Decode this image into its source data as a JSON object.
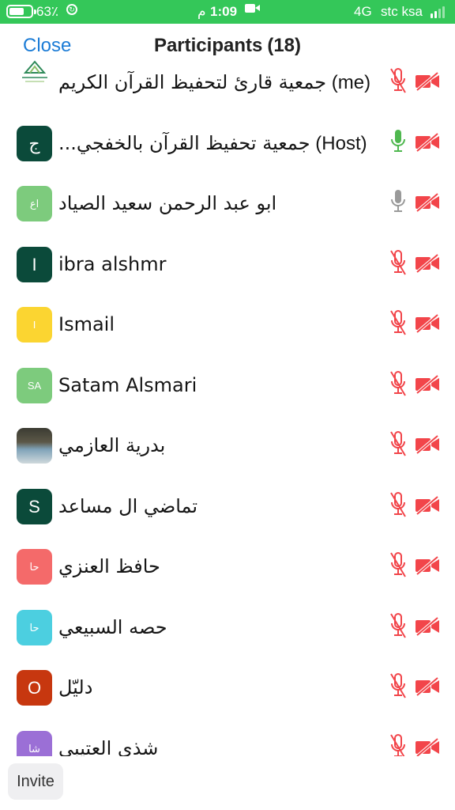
{
  "status_bar": {
    "battery_pct": "63٪",
    "time": "1:09",
    "ampm": "م",
    "network": "4G",
    "carrier": "stc ksa"
  },
  "header": {
    "close_label": "Close",
    "title": "Participants",
    "count": "(18)"
  },
  "participants": [
    {
      "name": "جمعية قارئ لتحفيظ القرآن الكريم",
      "tag": "(me)",
      "avatar_text": "",
      "avatar_type": "logo",
      "avatar_color": "#ffffff",
      "mic": "muted",
      "video": "off"
    },
    {
      "name": "جمعية تحفيظ القرآن بالخفجي...",
      "tag": "(Host)",
      "avatar_text": "ج",
      "avatar_type": "letter",
      "avatar_color": "#0b4a3a",
      "mic": "on",
      "video": "off"
    },
    {
      "name": "ابو عبد الرحمن سعيد الصياد",
      "tag": "",
      "avatar_text": "اع",
      "avatar_type": "letter-small",
      "avatar_color": "#7dcb7d",
      "mic": "idle",
      "video": "off"
    },
    {
      "name": "ibra alshmr",
      "tag": "",
      "avatar_text": "I",
      "avatar_type": "letter",
      "avatar_color": "#0b4a3a",
      "mic": "muted",
      "video": "off"
    },
    {
      "name": "Ismail",
      "tag": "",
      "avatar_text": "I",
      "avatar_type": "letter-small",
      "avatar_color": "#fbd531",
      "mic": "muted",
      "video": "off"
    },
    {
      "name": "Satam Alsmari",
      "tag": "",
      "avatar_text": "SA",
      "avatar_type": "letter-small",
      "avatar_color": "#7dcb7d",
      "mic": "muted",
      "video": "off"
    },
    {
      "name": "بدرية العازمي",
      "tag": "",
      "avatar_text": "",
      "avatar_type": "photo",
      "avatar_color": "#5c5848",
      "mic": "muted",
      "video": "off"
    },
    {
      "name": "تماضي ال مساعد",
      "tag": "",
      "avatar_text": "S",
      "avatar_type": "letter",
      "avatar_color": "#0b4a3a",
      "mic": "muted",
      "video": "off"
    },
    {
      "name": "حافظ العنزي",
      "tag": "",
      "avatar_text": "حا",
      "avatar_type": "letter-small",
      "avatar_color": "#f46a6a",
      "mic": "muted",
      "video": "off"
    },
    {
      "name": "حصه السبيعي",
      "tag": "",
      "avatar_text": "حا",
      "avatar_type": "letter-small",
      "avatar_color": "#4ccfe0",
      "mic": "muted",
      "video": "off"
    },
    {
      "name": "دليّل",
      "tag": "",
      "avatar_text": "O",
      "avatar_type": "letter",
      "avatar_color": "#c7370f",
      "mic": "muted",
      "video": "off"
    },
    {
      "name": "شذى العتيبي",
      "tag": "",
      "avatar_text": "شا",
      "avatar_type": "letter-small",
      "avatar_color": "#9b6fd6",
      "mic": "muted",
      "video": "off"
    }
  ],
  "invite_label": "Invite",
  "colors": {
    "status_bar": "#34c759",
    "accent": "#1c7cd6",
    "muted_red": "#f2454a",
    "mic_on": "#4fb84f",
    "mic_idle": "#9a9a9a"
  }
}
